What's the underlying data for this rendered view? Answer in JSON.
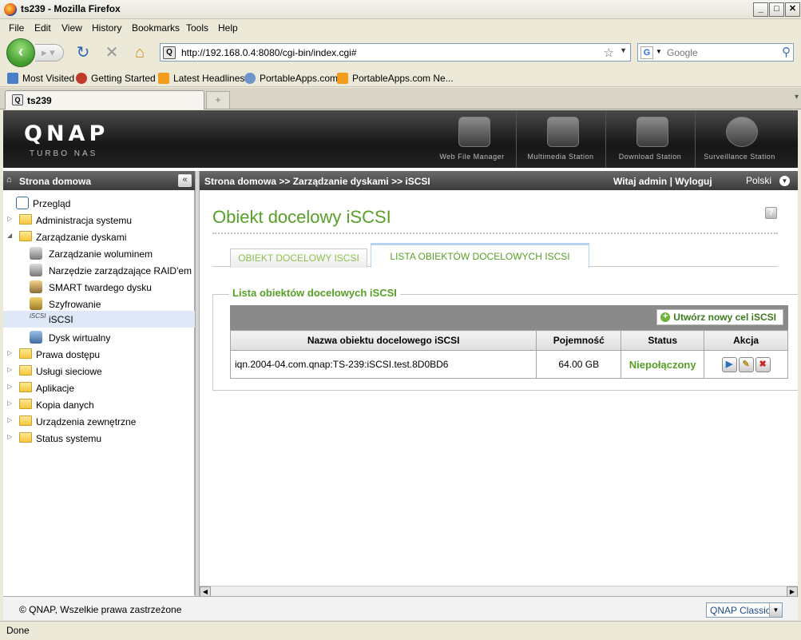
{
  "window": {
    "title": "ts239 - Mozilla Firefox"
  },
  "menu": [
    "File",
    "Edit",
    "View",
    "History",
    "Bookmarks",
    "Tools",
    "Help"
  ],
  "nav": {
    "url": "http://192.168.0.4:8080/cgi-bin/index.cgi#",
    "search_placeholder": "Google"
  },
  "bookmarks": [
    "Most Visited",
    "Getting Started",
    "Latest Headlines",
    "PortableApps.com",
    "PortableApps.com Ne..."
  ],
  "tabs": [
    {
      "label": "ts239"
    }
  ],
  "qnap": {
    "logo": "QNAP",
    "subtitle": "TURBO NAS",
    "apps": [
      "Web File Manager",
      "Multimedia Station",
      "Download Station",
      "Surveillance Station"
    ]
  },
  "sidebar": {
    "header": "Strona domowa",
    "items": [
      {
        "label": "Przegląd"
      },
      {
        "label": "Administracja systemu"
      },
      {
        "label": "Zarządzanie dyskami"
      },
      {
        "label": "Zarządzanie woluminem"
      },
      {
        "label": "Narzędzie zarządzające RAID'em"
      },
      {
        "label": "SMART twardego dysku"
      },
      {
        "label": "Szyfrowanie"
      },
      {
        "label": "iSCSI"
      },
      {
        "label": "Dysk wirtualny"
      },
      {
        "label": "Prawa dostępu"
      },
      {
        "label": "Usługi sieciowe"
      },
      {
        "label": "Aplikacje"
      },
      {
        "label": "Kopia danych"
      },
      {
        "label": "Urządzenia zewnętrzne"
      },
      {
        "label": "Status systemu"
      }
    ]
  },
  "header": {
    "breadcrumb": "Strona domowa >> Zarządzanie dyskami >> iSCSI",
    "welcome": "Witaj admin | Wyloguj",
    "language": "Polski"
  },
  "main": {
    "title": "Obiekt docelowy iSCSI",
    "tabs": [
      "OBIEKT DOCELOWY ISCSI",
      "LISTA OBIEKTÓW DOCELOWYCH ISCSI"
    ],
    "section_title": "Lista obiektów docelowych iSCSI",
    "create_button": "Utwórz nowy cel iSCSI",
    "table": {
      "columns": [
        "Nazwa obiektu docelowego iSCSI",
        "Pojemność",
        "Status",
        "Akcja"
      ],
      "rows": [
        {
          "name": "iqn.2004-04.com.qnap:TS-239:iSCSI.test.8D0BD6",
          "capacity": "64.00 GB",
          "status": "Niepołączony"
        }
      ]
    }
  },
  "footer": {
    "copyright": "© QNAP, Wszelkie prawa zastrzeżone",
    "theme": "QNAP Classic"
  },
  "status": "Done",
  "colors": {
    "accent_green": "#57a027",
    "header_dark": "#2a2a2a"
  }
}
